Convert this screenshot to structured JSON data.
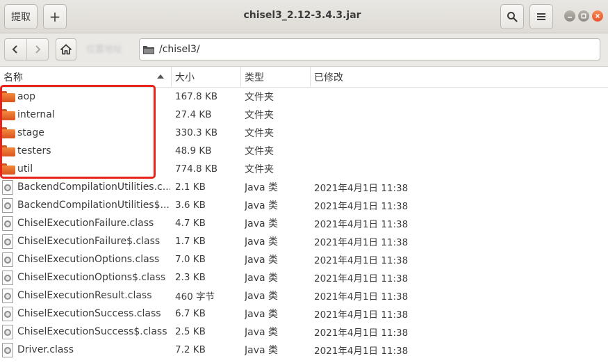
{
  "header": {
    "extract_label": "提取",
    "new_label": "+",
    "title": "chisel3_2.12-3.4.3.jar"
  },
  "toolbar": {
    "blurred_label": "位置地址",
    "path": "/chisel3/"
  },
  "columns": {
    "name": "名称",
    "size": "大小",
    "type": "类型",
    "modified": "已修改"
  },
  "rows": [
    {
      "kind": "folder",
      "name": "aop",
      "size": "167.8 KB",
      "type": "文件夹",
      "modified": ""
    },
    {
      "kind": "folder",
      "name": "internal",
      "size": "27.4 KB",
      "type": "文件夹",
      "modified": ""
    },
    {
      "kind": "folder",
      "name": "stage",
      "size": "330.3 KB",
      "type": "文件夹",
      "modified": ""
    },
    {
      "kind": "folder",
      "name": "testers",
      "size": "48.9 KB",
      "type": "文件夹",
      "modified": ""
    },
    {
      "kind": "folder",
      "name": "util",
      "size": "774.8 KB",
      "type": "文件夹",
      "modified": ""
    },
    {
      "kind": "java",
      "name": "BackendCompilationUtilities.c...",
      "size": "2.1 KB",
      "type": "Java 类",
      "modified": "2021年4月1日 11:38"
    },
    {
      "kind": "java",
      "name": "BackendCompilationUtilities$...",
      "size": "3.6 KB",
      "type": "Java 类",
      "modified": "2021年4月1日 11:38"
    },
    {
      "kind": "java",
      "name": "ChiselExecutionFailure.class",
      "size": "4.7 KB",
      "type": "Java 类",
      "modified": "2021年4月1日 11:38"
    },
    {
      "kind": "java",
      "name": "ChiselExecutionFailure$.class",
      "size": "1.7 KB",
      "type": "Java 类",
      "modified": "2021年4月1日 11:38"
    },
    {
      "kind": "java",
      "name": "ChiselExecutionOptions.class",
      "size": "7.0 KB",
      "type": "Java 类",
      "modified": "2021年4月1日 11:38"
    },
    {
      "kind": "java",
      "name": "ChiselExecutionOptions$.class",
      "size": "2.3 KB",
      "type": "Java 类",
      "modified": "2021年4月1日 11:38"
    },
    {
      "kind": "java",
      "name": "ChiselExecutionResult.class",
      "size": "460 字节",
      "type": "Java 类",
      "modified": "2021年4月1日 11:38"
    },
    {
      "kind": "java",
      "name": "ChiselExecutionSuccess.class",
      "size": "6.7 KB",
      "type": "Java 类",
      "modified": "2021年4月1日 11:38"
    },
    {
      "kind": "java",
      "name": "ChiselExecutionSuccess$.class",
      "size": "2.5 KB",
      "type": "Java 类",
      "modified": "2021年4月1日 11:38"
    },
    {
      "kind": "java",
      "name": "Driver.class",
      "size": "7.2 KB",
      "type": "Java 类",
      "modified": "2021年4月1日 11:38"
    }
  ],
  "colors": {
    "folder": "#e86a2a",
    "highlight": "#e8231c",
    "close": "#e5552a"
  }
}
